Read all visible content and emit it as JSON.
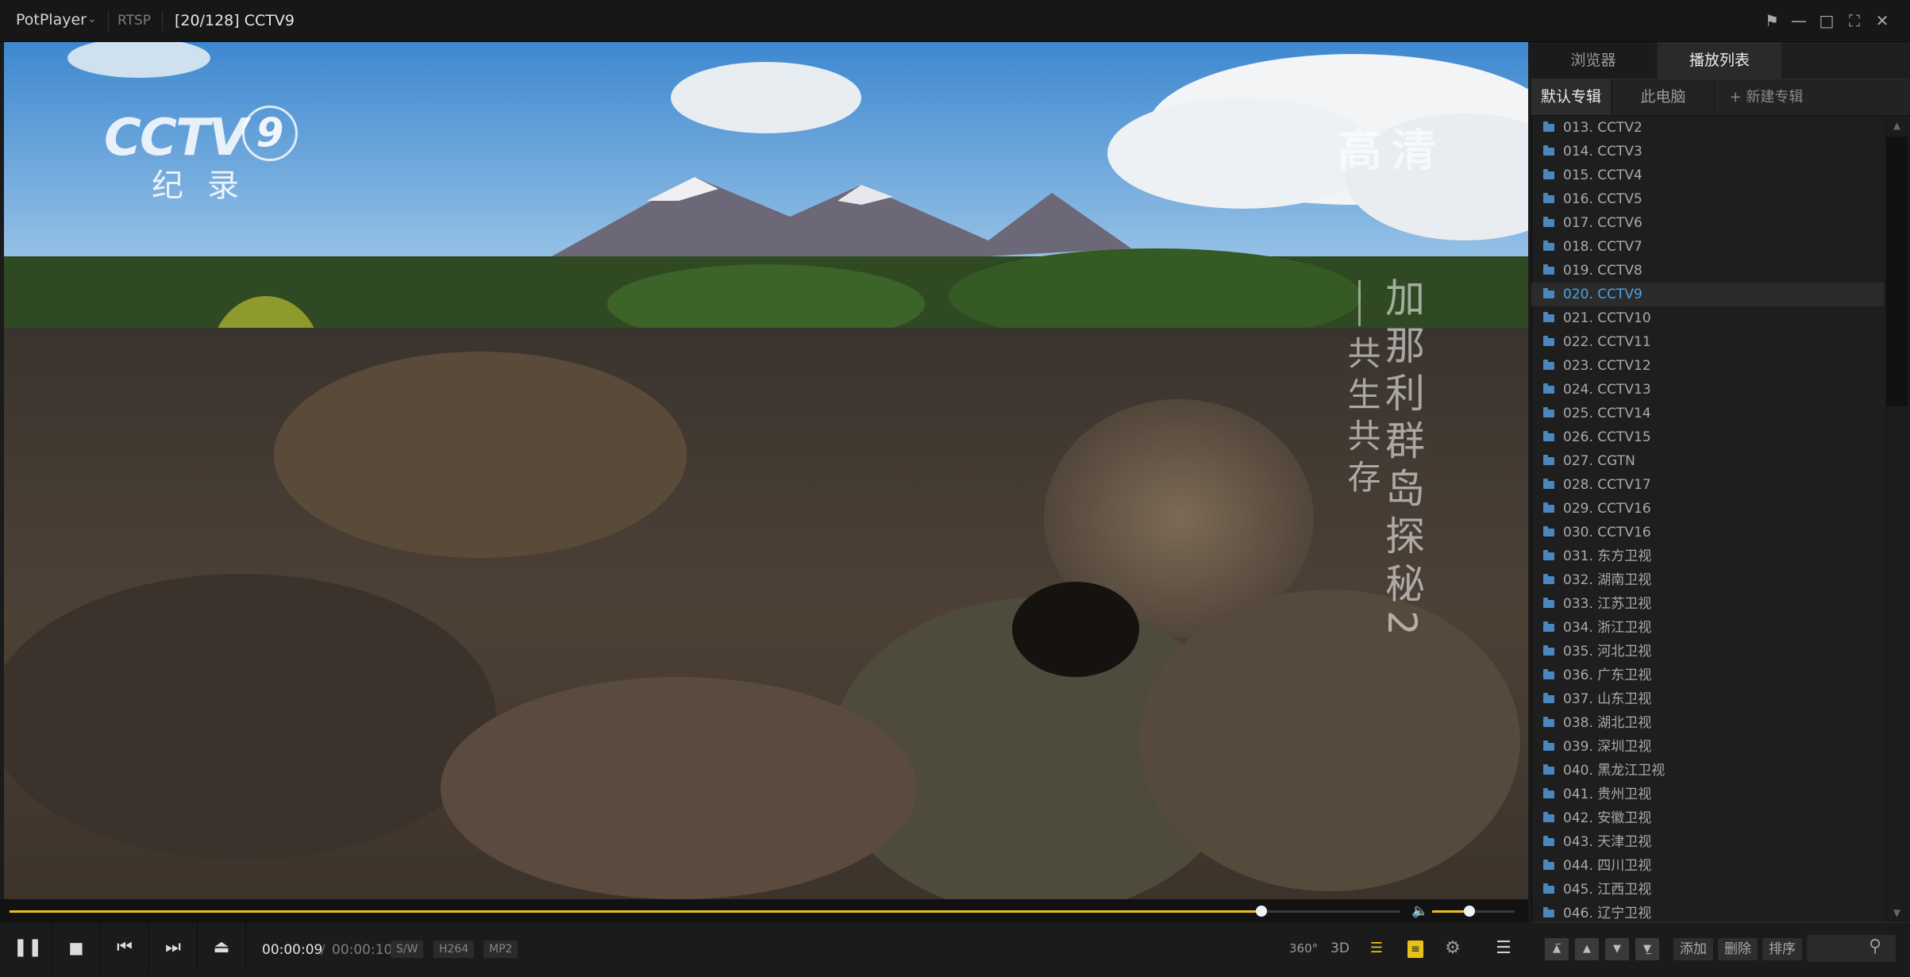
{
  "titlebar": {
    "app_name": "PotPlayer",
    "protocol": "RTSP",
    "now_playing": "[20/128] CCTV9"
  },
  "video": {
    "logo_text": "CCTV",
    "logo_number": "9",
    "logo_subtitle": "纪录",
    "hd_mark": "高清",
    "overlay_title": "加那利群岛探秘2",
    "overlay_subtitle": "共生共存"
  },
  "playback": {
    "current_time": "00:00:09",
    "separator": "/",
    "total_time": "00:00:10",
    "progress": 0.9,
    "volume": 0.45,
    "badges": [
      "S/W",
      "H264",
      "MP2"
    ],
    "extra_icons": [
      "360°",
      "3D"
    ]
  },
  "panel": {
    "tabs": [
      "浏览器",
      "播放列表"
    ],
    "active_tab": "播放列表",
    "folder_tabs": [
      "默认专辑",
      "此电脑",
      "+ 新建专辑"
    ],
    "items": [
      "013. CCTV2",
      "014. CCTV3",
      "015. CCTV4",
      "016. CCTV5",
      "017. CCTV6",
      "018. CCTV7",
      "019. CCTV8",
      "020. CCTV9",
      "021. CCTV10",
      "022. CCTV11",
      "023. CCTV12",
      "024. CCTV13",
      "025. CCTV14",
      "026. CCTV15",
      "027. CGTN",
      "028. CCTV17",
      "029. CCTV16",
      "030. CCTV16",
      "031. 东方卫视",
      "032. 湖南卫视",
      "033. 江苏卫视",
      "034. 浙江卫视",
      "035. 河北卫视",
      "036. 广东卫视",
      "037. 山东卫视",
      "038. 湖北卫视",
      "039. 深圳卫视",
      "040. 黑龙江卫视",
      "041. 贵州卫视",
      "042. 安徽卫视",
      "043. 天津卫视",
      "044. 四川卫视",
      "045. 江西卫视",
      "046. 辽宁卫视"
    ],
    "active_item": "020. CCTV9",
    "bottom_buttons": [
      "添加",
      "删除",
      "排序"
    ]
  },
  "colors": {
    "accent": "#e8c21a",
    "active_item": "#4aa3e8",
    "folder_icon": "#4a86c0"
  }
}
